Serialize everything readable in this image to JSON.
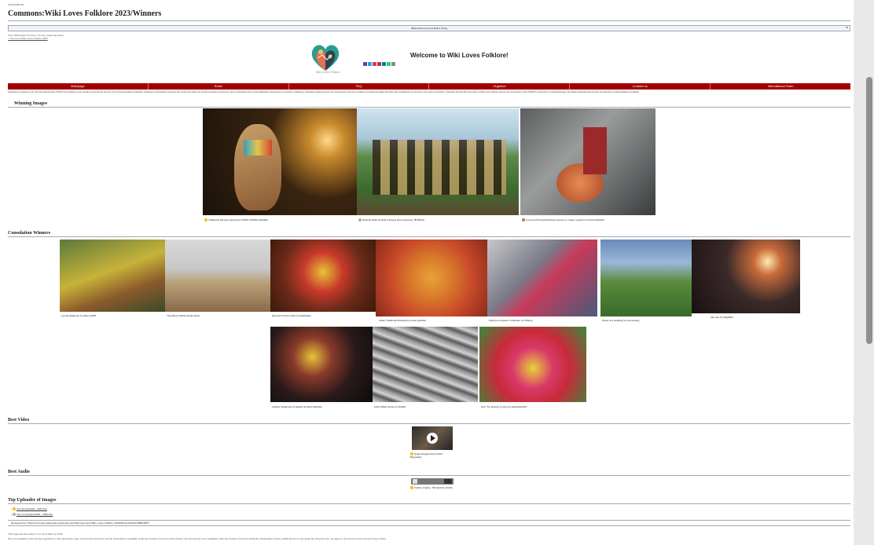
{
  "header": {
    "top_label": "ICONTRIBUTE",
    "title": "Commons:Wiki Loves Folklore 2023/Winners",
    "from_line": "From Wikimedia Commons, the free media repository",
    "back_link": "< Commons:Wiki Loves Folklore 2023"
  },
  "notice": {
    "text": "Wikimedia Commons Board Voting",
    "close": "×"
  },
  "banner": {
    "welcome": "Welcome to Wiki Loves Folklore!",
    "logo_caption": "Wiki Loves Folklore",
    "social_colors": [
      "#3b5998",
      "#1da1f2",
      "#e1306c",
      "#c4302b",
      "#0077b5",
      "#25d366",
      "#888888"
    ]
  },
  "nav": [
    "Mainpage",
    "Rules",
    "FAQ",
    "Organize",
    "Contact us",
    "International Team"
  ],
  "intro": "Celebrating a milestone year, the International Team of Wiki Loves Folklore is truly proudly announces the winners of the renowned global competition. Drawing an overwhelming response from across the globe, the contest received an impressive, all-out submissions from a joint application representing our countries. Following a meticulous judging process, the esteemed jury has now unveiled the exceptional images that have been awarded the top honours in this year's competition. Coinciding with the fifth anniversary of Wiki Loves Folklore and the sixth anniversary of the UNESCO Convention on Cultural Heritage, this edition showcased the richness and diversity of cultural traditions worldwide.",
  "sections": {
    "winning": "Winning Images",
    "consolation": "Consolation Winners",
    "video": "Best Video",
    "audio": "Best Audio",
    "uploader": "Top Uploader of Images"
  },
  "winning": [
    {
      "caption": "Traditional folk face painting by TARIO KUMAR HALDER",
      "medal": "#f2c200"
    },
    {
      "caption": "National Mask Festival of Papua New Guinea by JBYBOSA",
      "medal": "#b0b0b0"
    },
    {
      "caption": "A man performing bleaching process on copper vessel by Sumitmehta2010",
      "medal": "#c97a3a"
    }
  ],
  "consolation_row1": [
    "Lumad baalaman by Wammy668",
    "Thourika by Mohamed El Idrissi",
    "Red and Gold for Hills by HellasWasy",
    "Indian Traditional Wedding by Aman Agrahari",
    "Fishing net weaver of Manipur by Pdhang",
    "Piping at a wedding by rammeshwg",
    "Van Zee by Talayl004"
  ],
  "consolation_row2": [
    "Celeste Indigenous by Edgar Hornipeti Gabriela",
    "Little buffalo herder by Abdalih",
    "Holi: The festival of colors by AjayDutta1997"
  ],
  "video_caption": "Quad-stringed lute by IDriS Begondaw",
  "audio_caption": "Fruition singing - Mentawa by Hindia",
  "uploaders": [
    "User:Dondat1960 - 3945 files",
    "User:Amardegbohali01 - 2890 files"
  ],
  "retrieved": "Retrieved from \"https://commons.wikimedia.org/w/index.php?title=Commons:Wiki_Loves_Folklore_2023/Winners&oldid=788513957\"",
  "footer1": "This page was last edited on 15 June 2023, at 15:56.",
  "footer2": "Files are available under licenses specified on their description page. All structured data from the file namespace is available under the Creative Commons CC0 License; all unstructured text is available under the Creative Commons Attribution-ShareAlike License; additional terms may apply. By using this site, you agree to the Terms of Use and the Privacy Policy."
}
